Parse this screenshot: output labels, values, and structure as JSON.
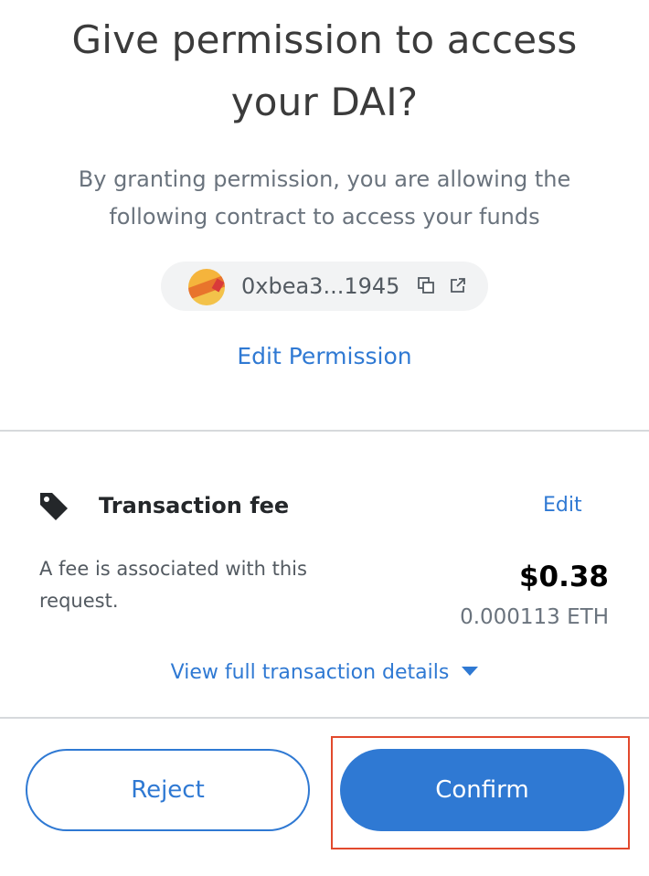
{
  "header": {
    "title_line1": "Give permission to access",
    "title_line2": "your DAI?",
    "subtitle_line1": "By granting permission, you are allowing the",
    "subtitle_line2": "following contract to access your funds"
  },
  "contract": {
    "address": "0xbea3...1945",
    "copy_icon": "copy-icon",
    "open_icon": "external-link-icon"
  },
  "edit_permission_label": "Edit Permission",
  "fee": {
    "icon": "tag-icon",
    "title": "Transaction fee",
    "edit_label": "Edit",
    "description_line1": "A fee is associated with this",
    "description_line2": "request.",
    "usd": "$0.38",
    "eth": "0.000113 ETH"
  },
  "details_label": "View full transaction details",
  "actions": {
    "reject_label": "Reject",
    "confirm_label": "Confirm"
  },
  "colors": {
    "accent": "#2f79d3",
    "highlight": "#e2492d",
    "divider": "#d6d9dc"
  }
}
